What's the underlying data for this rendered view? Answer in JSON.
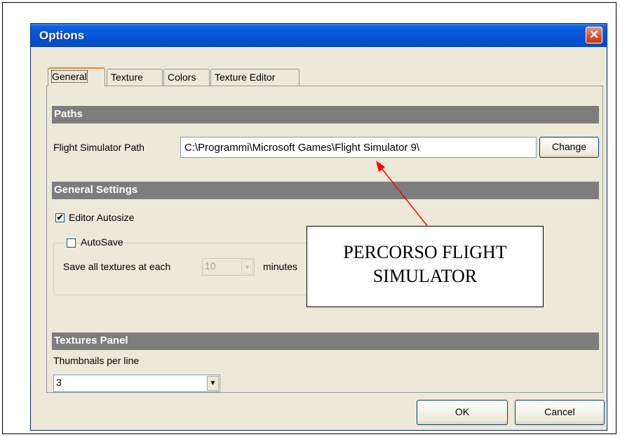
{
  "window": {
    "title": "Options",
    "close_symbol": "✕"
  },
  "tabs": [
    {
      "label": "General",
      "active": true
    },
    {
      "label": "Texture",
      "active": false
    },
    {
      "label": "Colors",
      "active": false
    },
    {
      "label": "Texture Editor",
      "active": false
    }
  ],
  "paths": {
    "header": "Paths",
    "fs_path_label": "Flight Simulator Path",
    "fs_path_value": "C:\\Programmi\\Microsoft Games\\Flight Simulator 9\\",
    "change_label": "Change"
  },
  "general_settings": {
    "header": "General Settings",
    "editor_autosize_label": "Editor Autosize",
    "editor_autosize_checked": true,
    "autosave_label": "AutoSave",
    "autosave_checked": false,
    "save_textures_label": "Save all textures at each",
    "save_interval_value": "10",
    "minutes_label": "minutes"
  },
  "textures_panel": {
    "header": "Textures Panel",
    "thumbnails_label": "Thumbnails per line",
    "thumbnails_value": "3"
  },
  "buttons": {
    "ok_label": "OK",
    "cancel_label": "Cancel"
  },
  "callout": {
    "line1": "PERCORSO FLIGHT",
    "line2": "SIMULATOR"
  },
  "colors": {
    "titlebar": "#0654d6",
    "section_header": "#7d7d7d",
    "arrow": "#ff0000",
    "dialog_bg": "#ece9d8"
  }
}
